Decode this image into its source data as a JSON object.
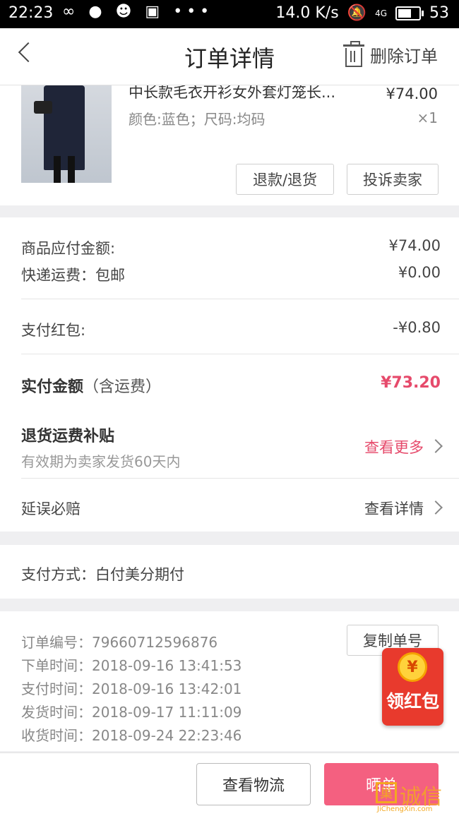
{
  "status_bar": {
    "time": "22:23",
    "left_icons": "∞ ● ☻ ▣ •••",
    "net_speed": "14.0 K/s",
    "signal": "4G",
    "battery": "53"
  },
  "nav": {
    "title": "订单详情",
    "delete_label": "删除订单"
  },
  "product": {
    "name": "中长款毛衣开衫女外套灯笼长...",
    "price": "¥74.00",
    "spec": "颜色:蓝色；尺码:均码",
    "qty": "×1",
    "refund_button": "退款/退货",
    "complain_button": "投诉卖家"
  },
  "money": {
    "goods_label": "商品应付金额:",
    "goods_value": "¥74.00",
    "shipping_label": "快递运费：包邮",
    "shipping_value": "¥0.00",
    "redpacket_label": "支付红包:",
    "redpacket_value": "-¥0.80",
    "paid_label": "实付金额",
    "paid_suffix": "（含运费）",
    "paid_value": "¥73.20",
    "return_subsidy_title": "退货运费补贴",
    "return_subsidy_desc": "有效期为卖家发货60天内",
    "return_subsidy_link": "查看更多",
    "delay_label": "延误必赔",
    "delay_link": "查看详情"
  },
  "payment": {
    "method": "支付方式：白付美分期付"
  },
  "order_info": {
    "order_no": "订单编号：79660712596876",
    "order_time": "下单时间：2018-09-16  13:41:53",
    "pay_time": "支付时间：2018-09-16  13:42:01",
    "ship_time": "发货时间：2018-09-17  11:11:09",
    "receive_time": "收货时间：2018-09-24  22:23:46",
    "copy_button": "复制单号"
  },
  "bottom": {
    "logistics_button": "查看物流",
    "share_button": "晒单"
  },
  "floating": {
    "coin_symbol": "¥",
    "label": "领红包"
  },
  "watermark": {
    "logo_char": "巢",
    "text": "诚信",
    "url": "JiChengXin.com"
  },
  "colors": {
    "accent": "#e64a6b",
    "primary_button": "#f46080",
    "redpacket": "#e83a2d"
  }
}
